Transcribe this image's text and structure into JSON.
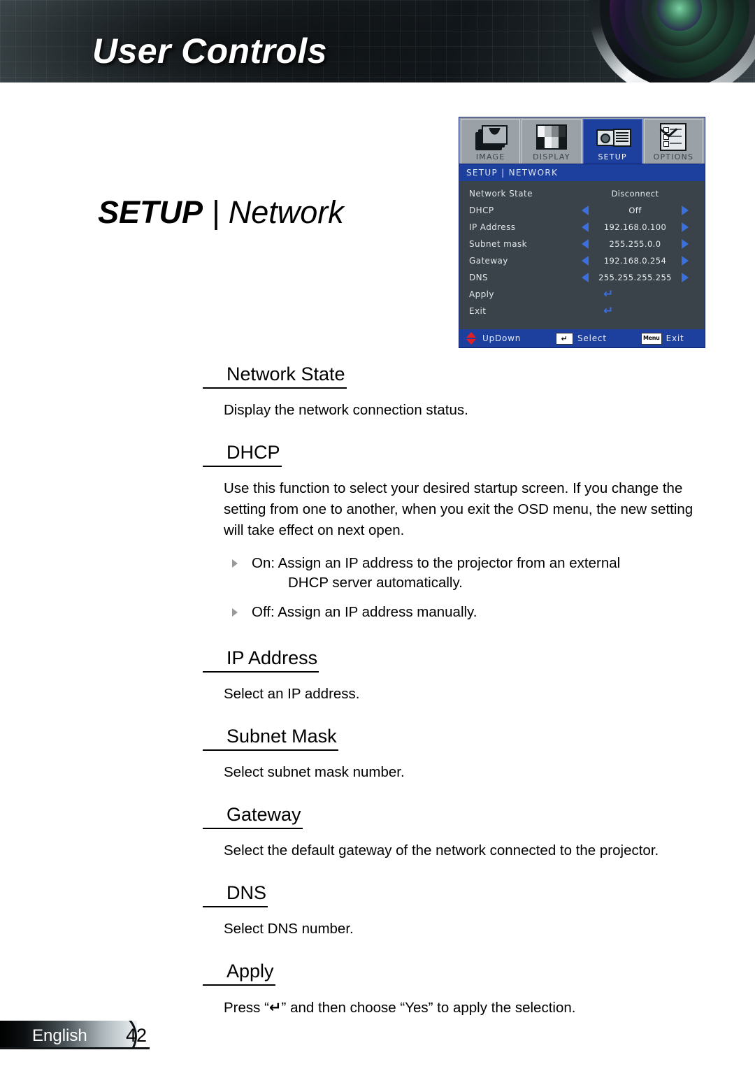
{
  "header": {
    "title": "User Controls"
  },
  "page_title": {
    "strong": "SETUP",
    "separator": " | ",
    "light": "Network"
  },
  "osd": {
    "tabs": [
      {
        "label": "IMAGE",
        "icon": "image-icon",
        "active": false
      },
      {
        "label": "DISPLAY",
        "icon": "display-icon",
        "active": false
      },
      {
        "label": "SETUP",
        "icon": "setup-icon",
        "active": true
      },
      {
        "label": "OPTIONS",
        "icon": "options-icon",
        "active": false
      }
    ],
    "breadcrumb": "SETUP  |  NETWORK",
    "rows": [
      {
        "name": "Network State",
        "value": "Disconnect",
        "arrows": false,
        "enter": false
      },
      {
        "name": "DHCP",
        "value": "Off",
        "arrows": true,
        "enter": false
      },
      {
        "name": "IP Address",
        "value": "192.168.0.100",
        "arrows": true,
        "enter": false
      },
      {
        "name": "Subnet mask",
        "value": "255.255.0.0",
        "arrows": true,
        "enter": false
      },
      {
        "name": "Gateway",
        "value": "192.168.0.254",
        "arrows": true,
        "enter": false
      },
      {
        "name": "DNS",
        "value": "255.255.255.255",
        "arrows": true,
        "enter": false
      },
      {
        "name": "Apply",
        "value": "",
        "arrows": false,
        "enter": true
      },
      {
        "name": "Exit",
        "value": "",
        "arrows": false,
        "enter": true
      }
    ],
    "footer": {
      "updown_label": "UpDown",
      "select_key": "↵",
      "select_label": "Select",
      "exit_key": "Menu",
      "exit_label": "Exit"
    },
    "colors": {
      "title_bar": "#1d3f9e",
      "body": "#394349",
      "arrow": "#3b6fe0",
      "updown_arrow": "#e21f26",
      "tab_inactive": "#9aa2a8"
    }
  },
  "sections": [
    {
      "heading": "Network State",
      "body": "Display the network connection status."
    },
    {
      "heading": "DHCP",
      "body": "Use this function to select your desired startup screen. If you change the setting from one to another, when you exit the OSD menu, the new setting will take effect on next open.",
      "bullets": [
        {
          "line1": "On: Assign an IP address to the projector from an external",
          "line2": "DHCP server automatically."
        },
        {
          "line1": "Off: Assign an IP address manually.",
          "line2": ""
        }
      ]
    },
    {
      "heading": "IP Address",
      "body": "Select an IP address."
    },
    {
      "heading": "Subnet Mask",
      "body": "Select subnet mask number."
    },
    {
      "heading": "Gateway",
      "body": "Select the default gateway of the network connected to the projector."
    },
    {
      "heading": "DNS",
      "body": "Select DNS number."
    },
    {
      "heading": "Apply",
      "body_pre": "Press “",
      "body_key": "↵",
      "body_post": "” and then choose “Yes” to apply the selection."
    }
  ],
  "page_footer": {
    "language": "English",
    "page_number": "42"
  }
}
